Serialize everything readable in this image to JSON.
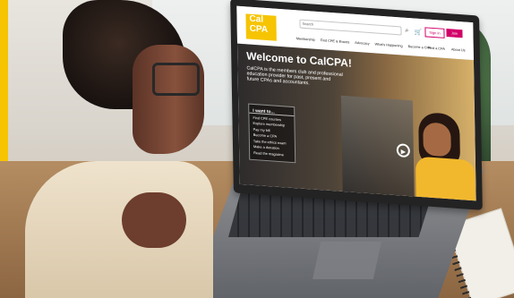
{
  "website": {
    "brand": {
      "logo_text": "Cal\nCPA",
      "colors": {
        "brand_yellow": "#f6c400",
        "accent_magenta": "#d10069"
      }
    },
    "search": {
      "placeholder": "Search"
    },
    "header_actions": {
      "sign_in": "Sign in",
      "join": "Join"
    },
    "nav": {
      "items": [
        "Membership",
        "Find CPE & Events",
        "Advocacy",
        "What's Happening",
        "Become a CPA"
      ],
      "right_items": [
        "Find a CPA",
        "About Us"
      ]
    },
    "hero": {
      "title": "Welcome to CalCPA!",
      "description": "CalCPA is the members club and professional education provider for past, present and future CPAs and accountants.",
      "menu": {
        "title": "I want to...",
        "items": [
          "Find CPE courses",
          "Explore membership",
          "Pay my bill",
          "Become a CPA",
          "Take the ethics exam",
          "Make a donation",
          "Read the magazine"
        ]
      }
    }
  }
}
